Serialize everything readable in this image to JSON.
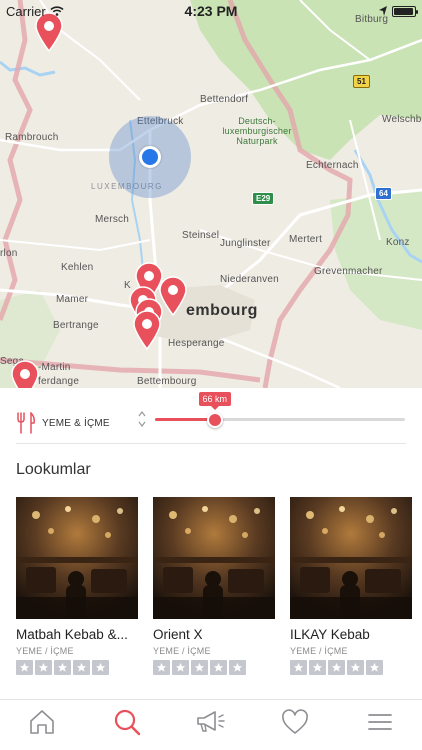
{
  "status_bar": {
    "carrier": "Carrier",
    "time": "4:23 PM",
    "battery_level": 0.95
  },
  "map": {
    "labels": {
      "bitburg": "Bitburg",
      "bettendorf": "Bettendorf",
      "ettelbruck": "Ettelbruck",
      "rambrouch": "Rambrouch",
      "welschb": "Welschb",
      "park": "Deutsch-luxemburgischer Naturpark",
      "echternach": "Echternach",
      "luxembourg_country": "LUXEMBOURG",
      "mersch": "Mersch",
      "steinsel": "Steinsel",
      "junglinster": "Junglinster",
      "mertert": "Mertert",
      "konz": "Konz",
      "arlon": "rlon",
      "kehlen": "Kehlen",
      "niederanven": "Niederanven",
      "grevenmacher": "Grevenmacher",
      "mamer": "Mamer",
      "luxembourg_city": "embourg",
      "bertrange": "Bertrange",
      "hesperange": "Hesperange",
      "saint_martin": "-Martin",
      "ferdange": "ferdange",
      "bettembourg": "Bettembourg",
      "k": "K",
      "sega": "Sega"
    },
    "shields": {
      "s51": "51",
      "e29": "E29",
      "s64": "64"
    },
    "colors": {
      "pin": "#e8505b",
      "location": "#2677e8",
      "water": "#a9d3f2",
      "forest": "#c9e3b5",
      "border": "#e4a6ab"
    }
  },
  "filter": {
    "category_icon": "fork-knife-icon",
    "category_label": "YEME & İÇME",
    "distance_label": "66 km",
    "distance_fraction": 0.24
  },
  "section": {
    "title": "Lookumlar"
  },
  "cards": [
    {
      "name": "Matbah Kebab &...",
      "category": "YEME / İÇME",
      "rating": 0
    },
    {
      "name": "Orient X",
      "category": "YEME / İÇME",
      "rating": 0
    },
    {
      "name": "ILKAY Kebab",
      "category": "YEME / İÇME",
      "rating": 0
    }
  ],
  "tabs": [
    {
      "name": "home-icon",
      "active": false
    },
    {
      "name": "search-icon",
      "active": true
    },
    {
      "name": "megaphone-icon",
      "active": false
    },
    {
      "name": "heart-icon",
      "active": false
    },
    {
      "name": "menu-icon",
      "active": false
    }
  ],
  "accent_color": "#e8505b"
}
